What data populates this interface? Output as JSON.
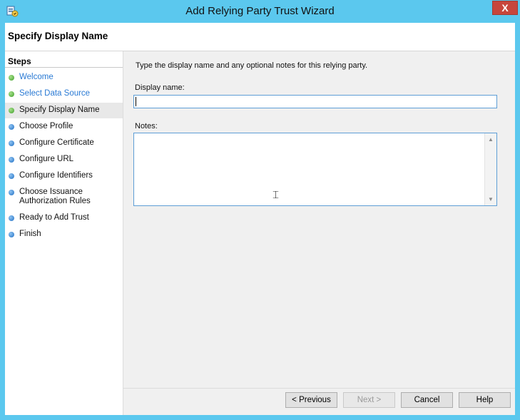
{
  "window": {
    "title": "Add Relying Party Trust Wizard",
    "close_label": "X",
    "accent_color": "#5bc8ee",
    "icon": "adfs-trust-icon"
  },
  "header": {
    "title": "Specify Display Name"
  },
  "steps": {
    "heading": "Steps",
    "items": [
      {
        "label": "Welcome",
        "state": "completed",
        "dot": "green"
      },
      {
        "label": "Select Data Source",
        "state": "completed",
        "dot": "green"
      },
      {
        "label": "Specify Display Name",
        "state": "current",
        "dot": "green"
      },
      {
        "label": "Choose Profile",
        "state": "pending",
        "dot": "blue"
      },
      {
        "label": "Configure Certificate",
        "state": "pending",
        "dot": "blue"
      },
      {
        "label": "Configure URL",
        "state": "pending",
        "dot": "blue"
      },
      {
        "label": "Configure Identifiers",
        "state": "pending",
        "dot": "blue"
      },
      {
        "label": "Choose Issuance Authorization Rules",
        "state": "pending",
        "dot": "blue"
      },
      {
        "label": "Ready to Add Trust",
        "state": "pending",
        "dot": "blue"
      },
      {
        "label": "Finish",
        "state": "pending",
        "dot": "blue"
      }
    ]
  },
  "content": {
    "instructions": "Type the display name and any optional notes for this relying party.",
    "display_name_label": "Display name:",
    "display_name_value": "",
    "notes_label": "Notes:",
    "notes_value": ""
  },
  "buttons": {
    "previous": "< Previous",
    "next": "Next >",
    "cancel": "Cancel",
    "help": "Help"
  }
}
